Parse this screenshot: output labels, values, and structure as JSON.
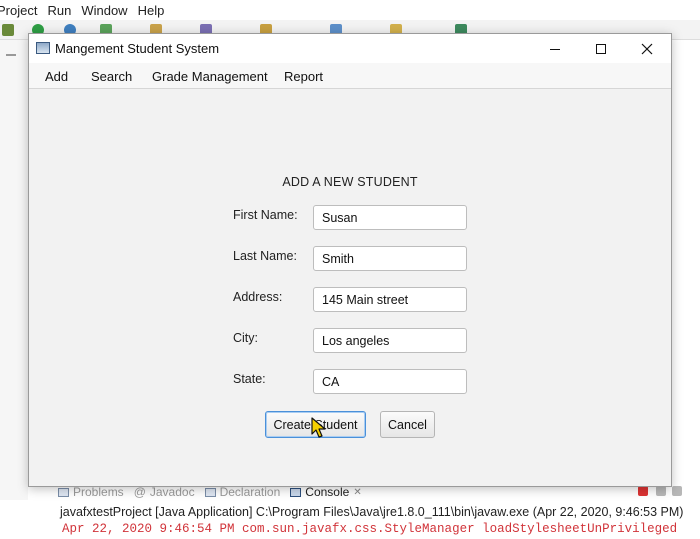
{
  "ide": {
    "menu": [
      "Project",
      "Run",
      "Window",
      "Help"
    ],
    "console_tabs": [
      {
        "label": "Problems",
        "active": false
      },
      {
        "label": "Javadoc",
        "active": false
      },
      {
        "label": "Declaration",
        "active": false
      },
      {
        "label": "Console",
        "active": true
      }
    ],
    "console_line1": "javafxtestProject [Java Application] C:\\Program Files\\Java\\jre1.8.0_111\\bin\\javaw.exe (Apr 22, 2020, 9:46:53 PM)",
    "console_line2": "Apr 22, 2020 9:46:54 PM com.sun.javafx.css.StyleManager loadStylesheetUnPrivileged"
  },
  "window": {
    "title": "Mangement Student System",
    "menu": [
      "Add",
      "Search",
      "Grade Management",
      "Report"
    ]
  },
  "form": {
    "title": "ADD A NEW STUDENT",
    "fields": [
      {
        "label": "First Name:",
        "value": "Susan"
      },
      {
        "label": "Last Name:",
        "value": "Smith"
      },
      {
        "label": "Address:",
        "value": "145 Main street"
      },
      {
        "label": "City:",
        "value": "Los angeles"
      },
      {
        "label": "State:",
        "value": "CA"
      }
    ],
    "create_button": "Create Student",
    "cancel_button": "Cancel"
  },
  "colors": {
    "console_error": "#d1343a",
    "focus_border": "#4a90d9"
  },
  "icons": [
    "app-icon",
    "minimize-icon",
    "maximize-icon",
    "close-icon",
    "mouse-cursor-icon"
  ]
}
